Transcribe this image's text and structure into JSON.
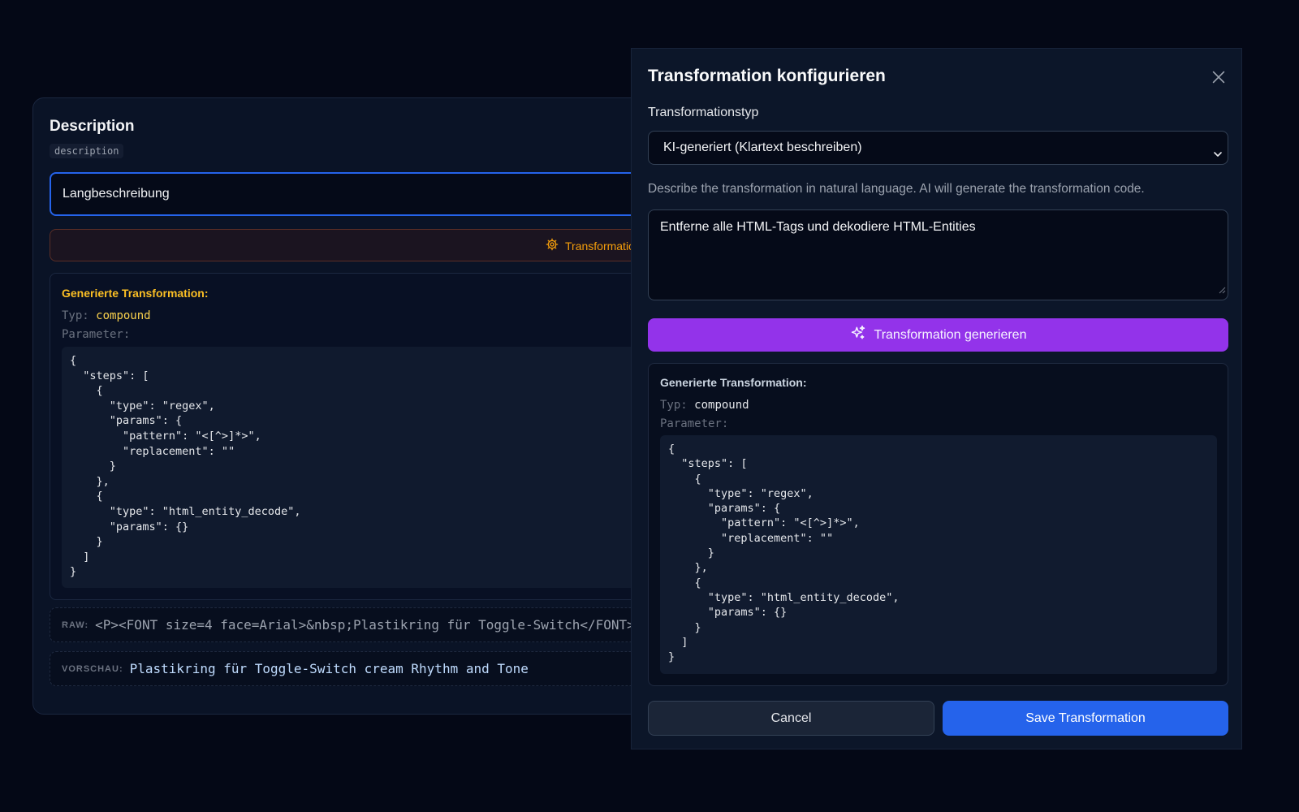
{
  "field_card": {
    "title": "Description",
    "key": "description",
    "label_value": "Langbeschreibung",
    "transform_button": "Transformation",
    "result": {
      "heading": "Generierte Transformation:",
      "type_label": "Typ:",
      "type_value": "compound",
      "params_label": "Parameter:",
      "code": "{\n  \"steps\": [\n    {\n      \"type\": \"regex\",\n      \"params\": {\n        \"pattern\": \"<[^>]*>\",\n        \"replacement\": \"\"\n      }\n    },\n    {\n      \"type\": \"html_entity_decode\",\n      \"params\": {}\n    }\n  ]\n}"
    },
    "raw_label": "RAW:",
    "raw_value": "<P><FONT size=4 face=Arial>&nbsp;Plastikring für Toggle-Switch</FONT>",
    "preview_label": "VORSCHAU:",
    "preview_value": "Plastikring für Toggle-Switch cream Rhythm and Tone"
  },
  "modal": {
    "title": "Transformation konfigurieren",
    "type_label": "Transformationstyp",
    "type_selected": "KI-generiert (Klartext beschreiben)",
    "help_text": "Describe the transformation in natural language. AI will generate the transformation code.",
    "description_value": "Entferne alle HTML-Tags und dekodiere HTML-Entities",
    "generate_button": "Transformation generieren",
    "result": {
      "heading": "Generierte Transformation:",
      "type_label": "Typ:",
      "type_value": "compound",
      "params_label": "Parameter:",
      "code": "{\n  \"steps\": [\n    {\n      \"type\": \"regex\",\n      \"params\": {\n        \"pattern\": \"<[^>]*>\",\n        \"replacement\": \"\"\n      }\n    },\n    {\n      \"type\": \"html_entity_decode\",\n      \"params\": {}\n    }\n  ]\n}"
    },
    "cancel_button": "Cancel",
    "save_button": "Save Transformation"
  },
  "colors": {
    "background": "#040816",
    "accent_blue": "#2563eb",
    "generate_purple": "#9333ea",
    "amber": "#fbbf24"
  },
  "icons": [
    "gear-icon",
    "close-icon",
    "chevron-down-icon",
    "sparkles-icon",
    "resize-grip-icon"
  ]
}
